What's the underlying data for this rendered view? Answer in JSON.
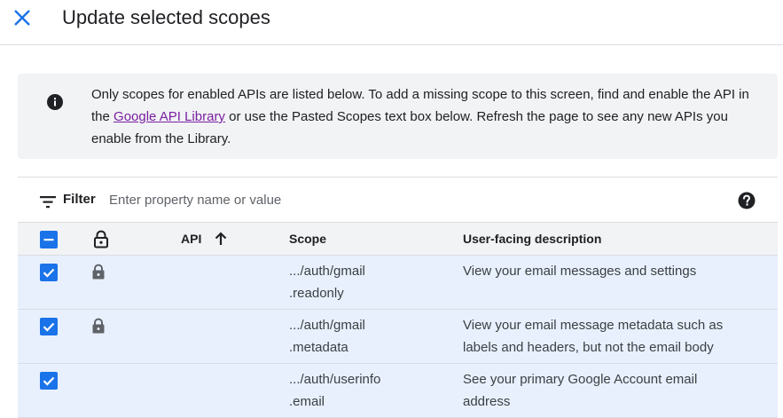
{
  "dialog": {
    "title": "Update selected scopes"
  },
  "banner": {
    "text_before": "Only scopes for enabled APIs are listed below. To add a missing scope to this screen, find and enable the API in the ",
    "link": "Google API Library",
    "text_after": " or use the Pasted Scopes text box below. Refresh the page to see any new APIs you enable from the Library."
  },
  "filter": {
    "label": "Filter",
    "placeholder": "Enter property name or value"
  },
  "table": {
    "columns": {
      "api": "API",
      "scope": "Scope",
      "description": "User-facing description"
    },
    "rows": [
      {
        "scope_line1": ".../auth/gmail",
        "scope_line2": ".readonly",
        "desc_line1": "View your email messages and settings",
        "desc_line2": "",
        "locked": true,
        "checked": true
      },
      {
        "scope_line1": ".../auth/gmail",
        "scope_line2": ".metadata",
        "desc_line1": "View your email message metadata such as",
        "desc_line2": "labels and headers, but not the email body",
        "locked": true,
        "checked": true
      },
      {
        "scope_line1": ".../auth/userinfo",
        "scope_line2": ".email",
        "desc_line1": "See your primary Google Account email",
        "desc_line2": "address",
        "locked": false,
        "checked": true
      }
    ]
  },
  "colors": {
    "accent": "#1a73e8",
    "link": "#7b1fa2",
    "row_selected": "#e8f0fe",
    "banner_bg": "#f1f3f4"
  },
  "icons": [
    "close-icon",
    "info-icon",
    "filter-icon",
    "help-icon",
    "lock-icon",
    "arrow-up-icon",
    "checkbox-indeterminate-icon",
    "checkbox-checked-icon"
  ]
}
